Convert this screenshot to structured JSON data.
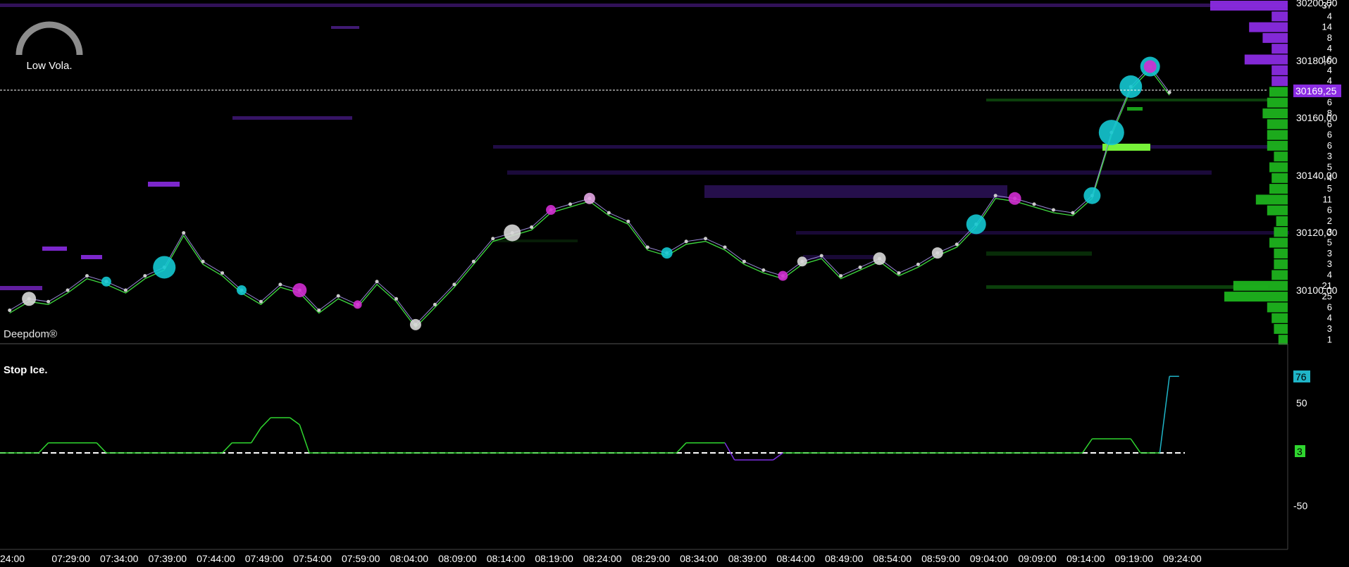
{
  "indicator": {
    "volatility_label": "Low Vola.",
    "gauge_level": 0.5
  },
  "brand": "Deepdom®",
  "price_axis": {
    "labels": [
      "30200,00",
      "30180,00",
      "30160,00",
      "30140,00",
      "30120,00",
      "30100,00"
    ],
    "current_price_label": "30169,25"
  },
  "volume_profile": {
    "labels": [
      "37",
      "4",
      "14",
      "8",
      "4",
      "16",
      "4",
      "4",
      "5",
      "6",
      "8",
      "6",
      "6",
      "6",
      "3",
      "5",
      "4",
      "5",
      "11",
      "6",
      "2",
      "3",
      "5",
      "3",
      "3",
      "4",
      "21",
      "25",
      "6",
      "4",
      "3",
      "1"
    ],
    "sell_color": "#8a2be2",
    "buy_color": "#1db31d"
  },
  "colors": {
    "cyan": "#14c8d2",
    "magenta": "#d22cd2",
    "white_bubble": "#d8d8d8",
    "pink_bubble": "#e3a6e3",
    "price_line": "#3fdc3f",
    "stop_line": "#2fd62f",
    "stop_line_neg": "#7a2ee0",
    "stop_line_final": "#1fb5c8"
  },
  "stop_ice": {
    "title": "Stop Ice.",
    "axis_labels": [
      "50",
      "-50"
    ],
    "badge_top": "76",
    "badge_bottom": "3"
  },
  "time_axis": {
    "labels": [
      "24:00",
      "07:29:00",
      "07:34:00",
      "07:39:00",
      "07:44:00",
      "07:49:00",
      "07:54:00",
      "07:59:00",
      "08:04:00",
      "08:09:00",
      "08:14:00",
      "08:19:00",
      "08:24:00",
      "08:29:00",
      "08:34:00",
      "08:39:00",
      "08:44:00",
      "08:49:00",
      "08:54:00",
      "08:59:00",
      "09:04:00",
      "09:09:00",
      "09:14:00",
      "09:19:00",
      "09:24:00"
    ]
  },
  "chart_data": [
    {
      "type": "line",
      "title": "",
      "xlabel": "",
      "ylabel": "",
      "ylim": [
        30087,
        30200
      ],
      "current_price": 30169.25,
      "series": [
        {
          "x": [
            "07:25",
            "07:27",
            "07:29",
            "07:31",
            "07:33",
            "07:35",
            "07:37",
            "07:39",
            "07:41",
            "07:43",
            "07:45",
            "07:47",
            "07:49",
            "07:51",
            "07:53",
            "07:55",
            "07:57",
            "07:59",
            "08:01",
            "08:03",
            "08:05",
            "08:07",
            "08:09",
            "08:11",
            "08:13",
            "08:15",
            "08:17",
            "08:19",
            "08:21",
            "08:23",
            "08:25",
            "08:27",
            "08:29",
            "08:31",
            "08:33",
            "08:35",
            "08:37",
            "08:39",
            "08:41",
            "08:43",
            "08:45",
            "08:47",
            "08:49",
            "08:51",
            "08:53",
            "08:55",
            "08:57",
            "08:59",
            "09:01",
            "09:03",
            "09:05",
            "09:07",
            "09:09",
            "09:11",
            "09:13",
            "09:15",
            "09:17",
            "09:19",
            "09:21",
            "09:23",
            "09:25"
          ],
          "values": [
            30093,
            30097,
            30096,
            30100,
            30105,
            30103,
            30100,
            30105,
            30108,
            30120,
            30110,
            30106,
            30100,
            30096,
            30102,
            30100,
            30093,
            30098,
            30095,
            30103,
            30097,
            30088,
            30095,
            30102,
            30110,
            30118,
            30120,
            30122,
            30128,
            30130,
            30132,
            30127,
            30124,
            30115,
            30113,
            30117,
            30118,
            30115,
            30110,
            30107,
            30105,
            30110,
            30112,
            30105,
            30108,
            30111,
            30106,
            30109,
            30113,
            30116,
            30123,
            30133,
            30132,
            30130,
            30128,
            30127,
            30133,
            30155,
            30171,
            30178,
            30169
          ]
        }
      ]
    },
    {
      "type": "line",
      "title": "Stop Ice.",
      "xlabel": "",
      "ylabel": "",
      "ylim": [
        -75,
        85
      ],
      "series": [
        {
          "x": [
            "07:24",
            "07:28",
            "07:29",
            "07:34",
            "07:35",
            "07:47",
            "07:48",
            "07:50",
            "07:51",
            "07:52",
            "07:54",
            "07:55",
            "07:56",
            "08:34",
            "08:35",
            "08:39",
            "08:40",
            "08:44",
            "08:45",
            "09:16",
            "09:17",
            "09:21",
            "09:22",
            "09:24",
            "09:25",
            "09:26"
          ],
          "values": [
            0,
            0,
            10,
            10,
            0,
            0,
            10,
            10,
            25,
            35,
            35,
            28,
            0,
            0,
            10,
            10,
            -7,
            -7,
            0,
            0,
            14,
            14,
            0,
            0,
            76,
            76
          ]
        }
      ]
    }
  ]
}
